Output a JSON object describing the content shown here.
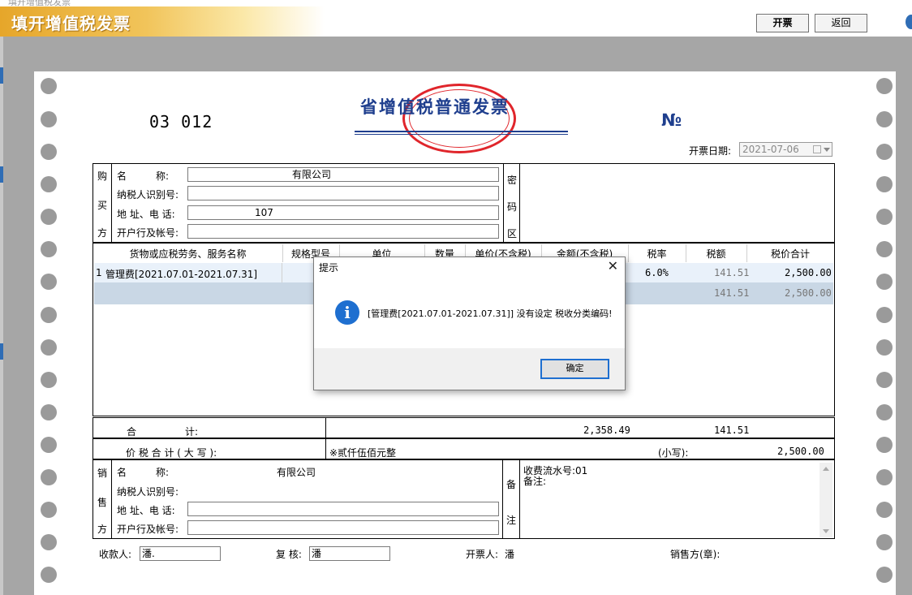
{
  "window": {
    "title": "填开增值税发票",
    "ghost_title": "填开增值税发票",
    "buttons": {
      "issue": "开票",
      "back": "返回"
    }
  },
  "invoice": {
    "code": "03  012",
    "title_prefix": "",
    "title": "省增值税普通发票",
    "number_label": "№",
    "number_value": "",
    "date_label": "开票日期:",
    "date_value": "2021-07-06",
    "seal_color": "#e0252b",
    "title_color": "#1f3f8e"
  },
  "buyer": {
    "section_chars": [
      "购",
      "买",
      "方"
    ],
    "labels": {
      "name": "名　　　称:",
      "tax_id": "纳税人识别号:",
      "address": "地 址、电 话:",
      "bank": "开户行及帐号:"
    },
    "values": {
      "name": "有限公司",
      "tax_id": "",
      "address": "107",
      "bank": ""
    },
    "cipher_chars": [
      "密",
      "码",
      "区"
    ]
  },
  "goods": {
    "columns": [
      "货物或应税劳务、服务名称",
      "规格型号",
      "单位",
      "数量",
      "单价(不含税)",
      "金额(不含税)",
      "税率",
      "税额",
      "税价合计"
    ],
    "rows": [
      {
        "index": "1",
        "name": "管理费[2021.07.01-2021.07.31]",
        "rate": "6.0%",
        "tax": "141.51",
        "total": "2,500.00"
      },
      {
        "index": "",
        "name": "",
        "rate": "",
        "tax": "141.51",
        "total": "2,500.00"
      }
    ]
  },
  "totals": {
    "sum_label": "合　　　　　计:",
    "amount": "2,358.49",
    "tax": "141.51",
    "capital_label": "价 税 合 计 ( 大 写 ):",
    "capital_value": "※贰仟伍佰元整",
    "small_label": "(小写):",
    "small_value": "2,500.00"
  },
  "seller": {
    "section_chars": [
      "销",
      "售",
      "方"
    ],
    "labels": {
      "name": "名　　　称:",
      "tax_id": "纳税人识别号:",
      "address": "地 址、电 话:",
      "bank": "开户行及帐号:"
    },
    "values": {
      "name": "有限公司",
      "tax_id": "",
      "address": "",
      "bank": ""
    },
    "remark_chars": [
      "备",
      "注"
    ],
    "remark_line1": "收费流水号:01",
    "remark_line2": "备注:"
  },
  "signatures": {
    "payee_label": "收款人:",
    "payee_value": "潘.",
    "reviewer_label": "复 核:",
    "reviewer_value": "潘",
    "drawer_label": "开票人:",
    "drawer_value": "潘",
    "seller_seal_label": "销售方(章):"
  },
  "dialog": {
    "title": "提示",
    "close": "✕",
    "icon": "i",
    "message": "[管理费[2021.07.01-2021.07.31]] 没有设定 税收分类编码!",
    "ok": "确定"
  }
}
